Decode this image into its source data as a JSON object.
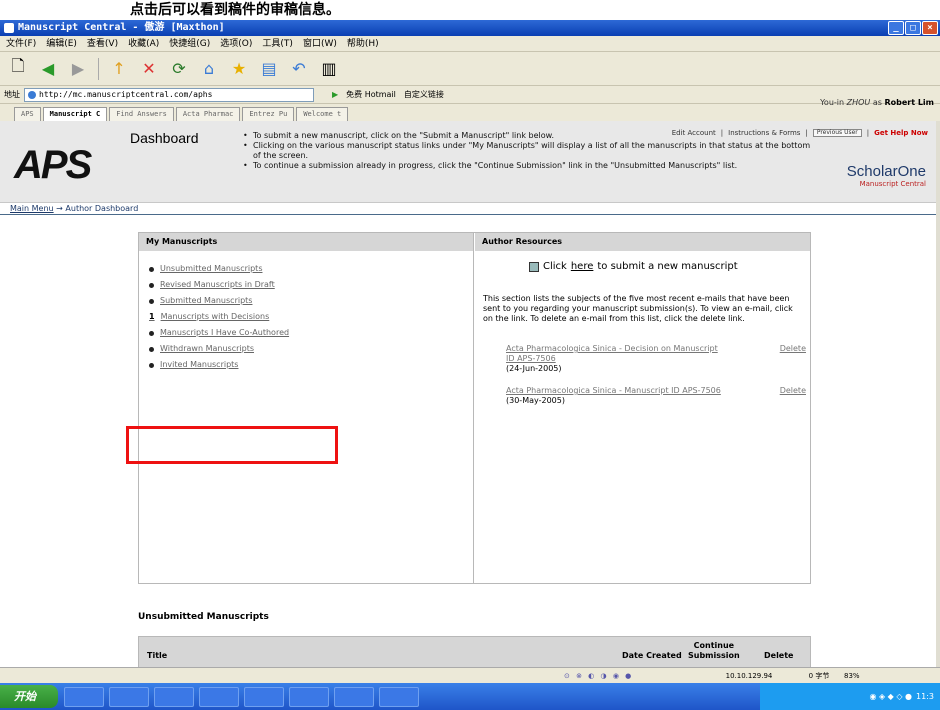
{
  "caption": "点击后可以看到稿件的审稿信息。",
  "window": {
    "title": "Manuscript Central - 傲游 [Maxthon]"
  },
  "menu": [
    "文件(F)",
    "编辑(E)",
    "查看(V)",
    "收藏(A)",
    "快捷组(G)",
    "选项(O)",
    "工具(T)",
    "窗口(W)",
    "帮助(H)"
  ],
  "address": {
    "label": "地址",
    "url": "http://mc.manuscriptcentral.com/aphs",
    "links": [
      "免费 Hotmail",
      "自定义链接"
    ]
  },
  "tabs": [
    "APS",
    "Manuscript C",
    "Find Answers",
    "Acta Pharmac",
    "Entrez Pu",
    "Welcome t"
  ],
  "header": {
    "top_links": [
      "Edit Account",
      "Instructions & Forms",
      "Previous User",
      "Get Help Now"
    ],
    "logo": "APS",
    "brand": "ScholarOne",
    "brand_sub": "Manuscript Central"
  },
  "breadcrumb": {
    "home": "Main Menu",
    "current": "Author Dashboard"
  },
  "logged_in": {
    "prefix": "You-in",
    "place": "ZHOU",
    "as": "as",
    "name": "Robert Lim"
  },
  "dashboard": {
    "title": "Dashboard",
    "instructions": [
      "To submit a new manuscript, click on the \"Submit a Manuscript\" link below.",
      "Clicking on the various manuscript status links under \"My Manuscripts\" will display a list of all the manuscripts in that status at the bottom of the screen.",
      "To continue a submission already in progress, click the \"Continue Submission\" link in the \"Unsubmitted Manuscripts\" list."
    ]
  },
  "my_manuscripts": {
    "heading": "My Manuscripts",
    "items": [
      "Unsubmitted Manuscripts",
      "Revised Manuscripts in Draft",
      "Submitted Manuscripts",
      "Manuscripts with Decisions",
      "Manuscripts I Have Co-Authored",
      "Withdrawn Manuscripts",
      "Invited Manuscripts"
    ],
    "counts": [
      "",
      "",
      "",
      "1",
      "",
      "",
      ""
    ]
  },
  "author_resources": {
    "heading": "Author Resources",
    "submit_prefix": "Click",
    "submit_link": "here",
    "submit_suffix": "to submit a new manuscript",
    "description": "This section lists the subjects of the five most recent e-mails that have been sent to you regarding your manuscript submission(s). To view an e-mail, click on the link. To delete an e-mail from this list, click the delete link.",
    "emails": [
      {
        "subject": "Acta Pharmacologica Sinica - Decision on Manuscript ID APS-7506",
        "date": "(24-Jun-2005)",
        "delete": "Delete"
      },
      {
        "subject": "Acta Pharmacologica Sinica - Manuscript ID APS-7506",
        "date": "(30-May-2005)",
        "delete": "Delete"
      }
    ]
  },
  "unsubmitted": {
    "heading": "Unsubmitted Manuscripts",
    "columns": {
      "title": "Title",
      "date": "Date Created",
      "cont1": "Continue",
      "cont2": "Submission",
      "delete": "Delete"
    }
  },
  "status": {
    "ip": "10.10.129.94",
    "bytes": "0 字节",
    "zoom": "83%"
  },
  "taskbar": {
    "start": "开始",
    "clock": "11:3"
  }
}
